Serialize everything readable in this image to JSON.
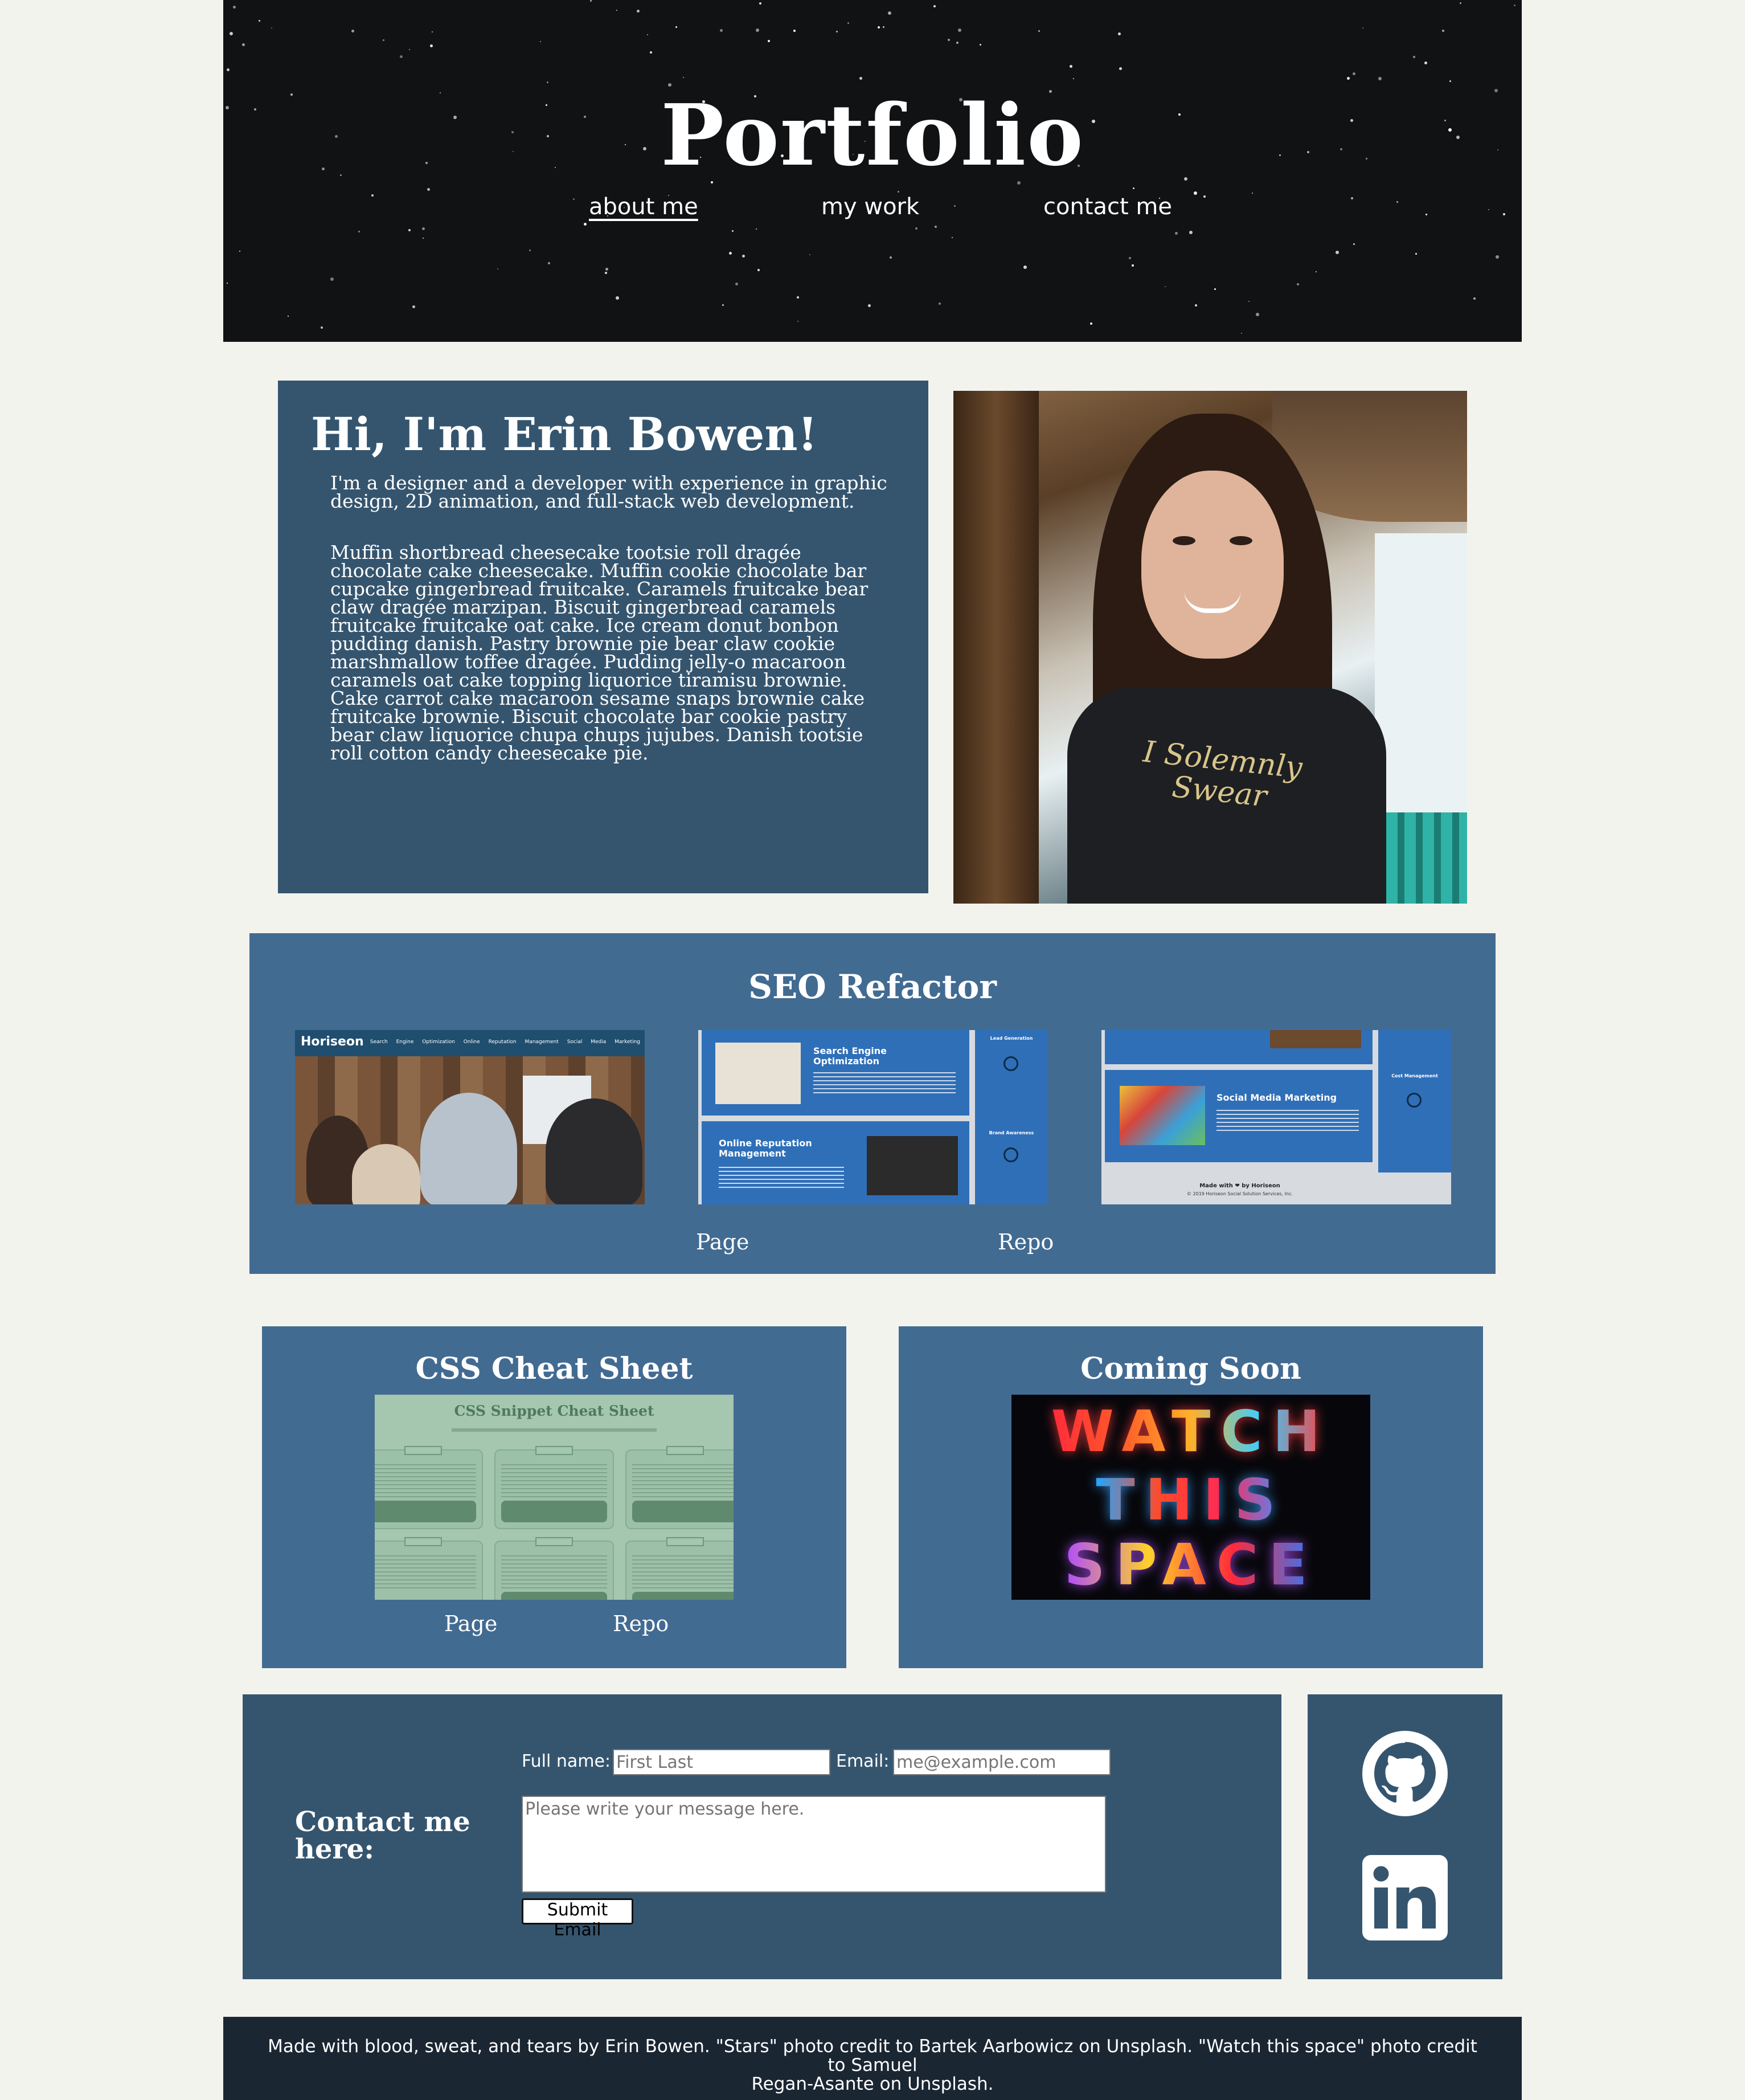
{
  "header": {
    "title": "Portfolio",
    "nav": [
      {
        "label": "about me",
        "active": true
      },
      {
        "label": "my work",
        "active": false
      },
      {
        "label": "contact me",
        "active": false
      }
    ]
  },
  "about": {
    "heading": "Hi, I'm Erin Bowen!",
    "intro": "I'm a designer and a developer with experience in graphic design, 2D animation, and full-stack web development.",
    "body": "Muffin shortbread cheesecake tootsie roll dragée chocolate cake cheesecake. Muffin cookie chocolate bar cupcake gingerbread fruitcake. Caramels fruitcake bear claw dragée marzipan. Biscuit gingerbread caramels fruitcake fruitcake oat cake. Ice cream donut bonbon pudding danish. Pastry brownie pie bear claw cookie marshmallow toffee dragée. Pudding jelly-o macaroon caramels oat cake topping liquorice tiramisu brownie. Cake carrot cake macaroon sesame snaps brownie cake fruitcake brownie. Biscuit chocolate bar cookie pastry bear claw liquorice chupa chups jujubes. Danish tootsie roll cotton candy cheesecake pie.",
    "photo_shirt_text": "I Solemnly Swear"
  },
  "projects": {
    "seo": {
      "title": "SEO Refactor",
      "page_label": "Page",
      "repo_label": "Repo",
      "shot1": {
        "logo": "Horiseon",
        "links": "Search Engine Optimization  Online Reputation Management  Social Media Marketing"
      },
      "shot2": {
        "tile1": "Search Engine Optimization",
        "tile2": "Online Reputation Management",
        "side1": "Lead Generation",
        "side2": "Brand Awareness"
      },
      "shot3": {
        "tile1": "Social Media Marketing",
        "side1": "Cost Management",
        "made_with": "Made with ❤ by Horiseon",
        "copyright": "© 2019 Horiseon Social Solution Services, Inc."
      }
    },
    "css": {
      "title": "CSS Cheat Sheet",
      "page_label": "Page",
      "repo_label": "Repo",
      "sheet_title": "CSS Snippet Cheat Sheet"
    },
    "soon": {
      "title": "Coming Soon",
      "sign_rows": [
        "WATCH",
        "THIS",
        "SPACE"
      ]
    }
  },
  "contact": {
    "heading": "Contact me here:",
    "full_name_label": "Full name:",
    "full_name_placeholder": "First Last",
    "email_label": "Email:",
    "email_placeholder": "me@example.com",
    "message_placeholder": "Please write your message here.",
    "submit_label": "Submit Email"
  },
  "social": {
    "icons": [
      "github-icon",
      "linkedin-icon"
    ]
  },
  "footer": {
    "line1": "Made with blood, sweat, and tears by Erin Bowen. \"Stars\" photo credit to Bartek Aarbowicz on Unsplash. \"Watch this space\" photo credit to Samuel",
    "line2": "Regan-Asante on Unsplash."
  },
  "colors": {
    "page_bg": "#f3f3ee",
    "header_bg": "#101214",
    "about_bg": "#35556f",
    "card_bg": "#426b92",
    "footer_bg": "#1b2633"
  }
}
